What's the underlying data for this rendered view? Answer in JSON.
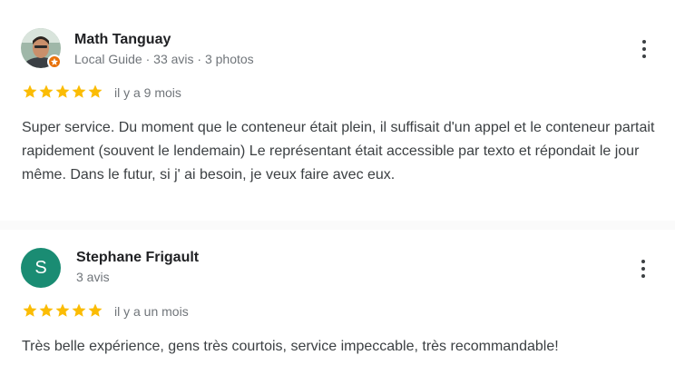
{
  "reviews": [
    {
      "author": "Math Tanguay",
      "meta": "Local Guide · 33 avis · 3 photos",
      "rating": 5,
      "date": "il y a 9 mois",
      "text": "Super service. Du moment que le conteneur était plein, il suffisait d'un appel et le conteneur partait rapidement (souvent le lendemain) Le représentant était accessible par texto et répondait le jour même. Dans le futur, si j' ai besoin, je veux faire avec eux."
    },
    {
      "author": "Stephane Frigault",
      "avatar_letter": "S",
      "meta": "3 avis",
      "rating": 5,
      "date": "il y a un mois",
      "text": "Très belle expérience, gens très courtois, service impeccable, très recommandable!"
    }
  ],
  "colors": {
    "star": "#fbbc04",
    "badge": "#e8710a",
    "avatar_bg": "#1a8c73"
  },
  "icons": {
    "menu": "more-vertical-icon",
    "star": "star-icon",
    "badge": "local-guide-badge-icon"
  }
}
